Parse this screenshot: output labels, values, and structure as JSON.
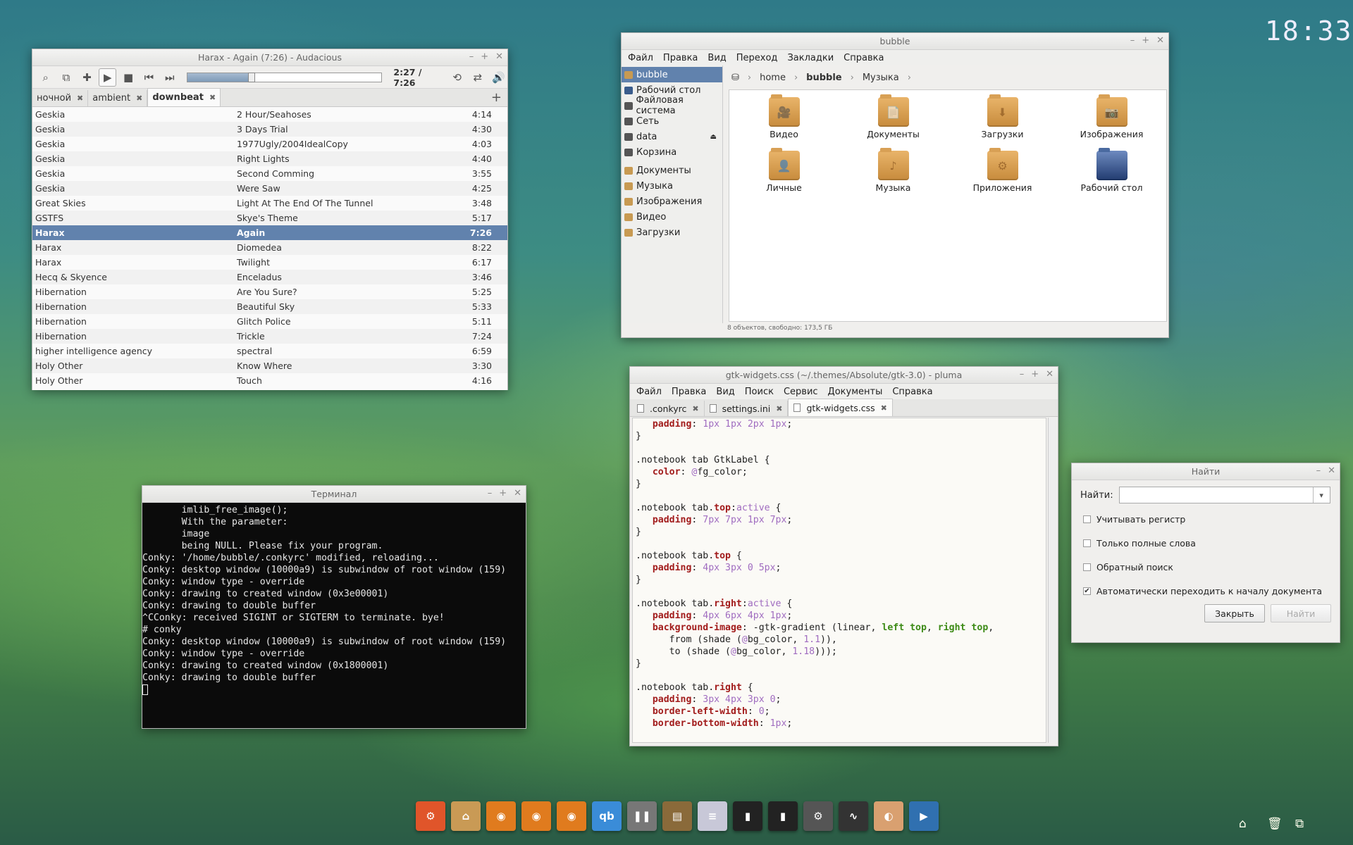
{
  "clock": "18:33",
  "audacious": {
    "title": "Harax - Again (7:26) - Audacious",
    "time": "2:27 / 7:26",
    "progress": 0.33,
    "tabs": [
      "ночной",
      "ambient",
      "downbeat"
    ],
    "rows": [
      [
        "Geskia",
        "2 Hour/Seahoses",
        "4:14"
      ],
      [
        "Geskia",
        "3 Days Trial",
        "4:30"
      ],
      [
        "Geskia",
        "1977Ugly/2004IdealCopy",
        "4:03"
      ],
      [
        "Geskia",
        "Right Lights",
        "4:40"
      ],
      [
        "Geskia",
        "Second Comming",
        "3:55"
      ],
      [
        "Geskia",
        "Were Saw",
        "4:25"
      ],
      [
        "Great Skies",
        "Light At The End Of The Tunnel",
        "3:48"
      ],
      [
        "GSTFS",
        "Skye's Theme",
        "5:17"
      ],
      [
        "Harax",
        "Again",
        "7:26"
      ],
      [
        "Harax",
        "Diomedea",
        "8:22"
      ],
      [
        "Harax",
        "Twilight",
        "6:17"
      ],
      [
        "Hecq & Skyence",
        "Enceladus",
        "3:46"
      ],
      [
        "Hibernation",
        "Are You Sure?",
        "5:25"
      ],
      [
        "Hibernation",
        "Beautiful Sky",
        "5:33"
      ],
      [
        "Hibernation",
        "Glitch Police",
        "5:11"
      ],
      [
        "Hibernation",
        "Trickle",
        "7:24"
      ],
      [
        "higher intelligence agency",
        "spectral",
        "6:59"
      ],
      [
        "Holy Other",
        "Know Where",
        "3:30"
      ],
      [
        "Holy Other",
        "Touch",
        "4:16"
      ]
    ],
    "selected_row": 8
  },
  "fm": {
    "title": "bubble",
    "menu": [
      "Файл",
      "Правка",
      "Вид",
      "Переход",
      "Закладки",
      "Справка"
    ],
    "places": [
      {
        "label": "bubble",
        "icon": "home-icon"
      },
      {
        "label": "Рабочий стол",
        "icon": "desktop-icon"
      },
      {
        "label": "Файловая система",
        "icon": "filesystem-icon"
      },
      {
        "label": "Сеть",
        "icon": "network-icon"
      },
      {
        "label": "data",
        "icon": "drive-icon"
      },
      {
        "label": "Корзина",
        "icon": "trash-icon"
      }
    ],
    "bookmarks": [
      "Документы",
      "Музыка",
      "Изображения",
      "Видео",
      "Загрузки"
    ],
    "crumbs": [
      "home",
      "bubble",
      "Музыка"
    ],
    "items": [
      {
        "label": "Видео",
        "glyph": "🎥"
      },
      {
        "label": "Документы",
        "glyph": "📄"
      },
      {
        "label": "Загрузки",
        "glyph": "⬇"
      },
      {
        "label": "Изображения",
        "glyph": "📷"
      },
      {
        "label": "Личные",
        "glyph": "👤"
      },
      {
        "label": "Музыка",
        "glyph": "♪"
      },
      {
        "label": "Приложения",
        "glyph": "⚙"
      },
      {
        "label": "Рабочий стол",
        "glyph": ""
      }
    ],
    "status": "8 объектов, свободно: 173,5 ГБ"
  },
  "pluma": {
    "title": "gtk-widgets.css (~/.themes/Absolute/gtk-3.0) - pluma",
    "menu": [
      "Файл",
      "Правка",
      "Вид",
      "Поиск",
      "Сервис",
      "Документы",
      "Справка"
    ],
    "tabs": [
      ".conkyrc",
      "settings.ini",
      "gtk-widgets.css"
    ]
  },
  "terminal": {
    "title": "Терминал",
    "lines": [
      "       imlib_free_image();",
      "",
      "       With the parameter:",
      "",
      "       image",
      "",
      "       being NULL. Please fix your program.",
      "Conky: '/home/bubble/.conkyrc' modified, reloading...",
      "Conky: desktop window (10000a9) is subwindow of root window (159)",
      "Conky: window type - override",
      "Conky: drawing to created window (0x3e00001)",
      "Conky: drawing to double buffer",
      "^CConky: received SIGINT or SIGTERM to terminate. bye!",
      "# conky",
      "Conky: desktop window (10000a9) is subwindow of root window (159)",
      "Conky: window type - override",
      "Conky: drawing to created window (0x1800001)",
      "Conky: drawing to double buffer"
    ]
  },
  "find": {
    "title": "Найти",
    "label": "Найти:",
    "options": [
      {
        "label": "Учитывать регистр",
        "checked": false
      },
      {
        "label": "Только полные слова",
        "checked": false
      },
      {
        "label": "Обратный поиск",
        "checked": false
      },
      {
        "label": "Автоматически переходить к началу документа",
        "checked": true
      }
    ],
    "close": "Закрыть",
    "find": "Найти"
  },
  "dock": [
    {
      "name": "ubuntu-icon",
      "glyph": "⚙",
      "color": "#e0552a"
    },
    {
      "name": "home-folder-icon",
      "glyph": "⌂",
      "color": "#c99a55"
    },
    {
      "name": "eye-icon",
      "glyph": "◉",
      "color": "#e07b1e"
    },
    {
      "name": "eye-icon",
      "glyph": "◉",
      "color": "#e07b1e"
    },
    {
      "name": "eye-icon",
      "glyph": "◉",
      "color": "#e07b1e"
    },
    {
      "name": "qbittorrent-icon",
      "glyph": "qb",
      "color": "#3a8cd8"
    },
    {
      "name": "pause-icon",
      "glyph": "❚❚",
      "color": "#777"
    },
    {
      "name": "archive-icon",
      "glyph": "▤",
      "color": "#8a6a3a"
    },
    {
      "name": "text-editor-icon",
      "glyph": "≡",
      "color": "#c8c8d8"
    },
    {
      "name": "terminal-icon",
      "glyph": "▮",
      "color": "#222"
    },
    {
      "name": "terminal-icon",
      "glyph": "▮",
      "color": "#222"
    },
    {
      "name": "settings-icon",
      "glyph": "⚙",
      "color": "#555"
    },
    {
      "name": "system-monitor-icon",
      "glyph": "∿",
      "color": "#333"
    },
    {
      "name": "eye-viewer-icon",
      "glyph": "◐",
      "color": "#d9a070"
    },
    {
      "name": "video-player-icon",
      "glyph": "▶",
      "color": "#3070b0"
    }
  ]
}
